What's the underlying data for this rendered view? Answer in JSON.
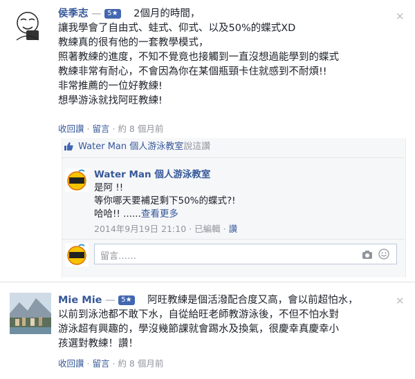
{
  "comments": [
    {
      "author": "侯季志",
      "dash": "—",
      "badge": "5★",
      "lines": [
        "2個月的時間，",
        "讓我學會了自由式、蛙式、仰式、以及50%的蝶式XD",
        "教練真的很有他的一套教學模式，",
        "照著教練的進度，不知不覺竟也接觸到一直沒想過能學到的蝶式",
        "教練非常有耐心，不會因為你在某個瓶頸卡住就感到不耐煩!!",
        "非常推薦的一位好教練!",
        "想學游泳就找阿旺教練!"
      ],
      "meta": {
        "retract": "收回讚",
        "sep1": "·",
        "reply": "留言",
        "sep2": "·",
        "time": "約 8 個月前"
      },
      "reply_summary": {
        "name": "Water Man 個人游泳教室",
        "suffix": "說這讚"
      },
      "reply": {
        "author": "Water Man 個人游泳教室",
        "lines": [
          "是阿 !!",
          "等你哪天要補足剩下50%的蝶式?!",
          "哈哈!! ......"
        ],
        "see_more": "查看更多",
        "meta": {
          "time": "2014年9月19日 21:10",
          "sep1": "·",
          "edited": "已編輯",
          "sep2": "·",
          "like": "讚"
        }
      },
      "composer_placeholder": "留言……"
    },
    {
      "author": "Mie Mie",
      "dash": "—",
      "badge": "5★",
      "lines": [
        "阿旺教練是個活潑配合度又高，會以前超怕水，",
        "以前到泳池都不敢下水，自從給旺老師教游泳後，不但不怕水對",
        "游泳超有興趣的，學沒幾節課就會踢水及換氣，很慶幸真慶幸小",
        "孩選對教練！讚！"
      ],
      "meta": {
        "retract": "收回讚",
        "sep1": "·",
        "reply": "留言",
        "sep2": "·",
        "time": "約 8 個月前"
      }
    }
  ],
  "icons": {
    "close": "close-icon",
    "thumb": "thumbs-up-icon",
    "camera": "camera-icon"
  },
  "colors": {
    "link": "#365899",
    "muted": "#90949c",
    "badge": "#4267b2"
  }
}
